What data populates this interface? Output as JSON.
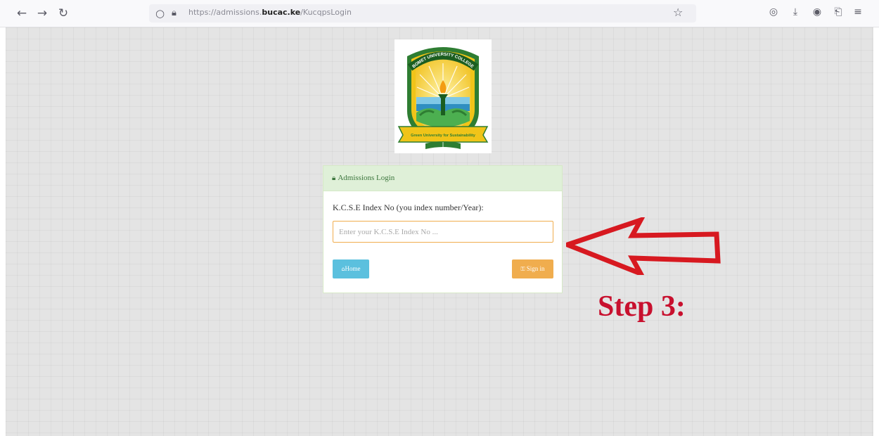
{
  "browser": {
    "url_prefix": "https://admissions.",
    "url_domain": "bucac.ke",
    "url_path": "/KucqpsLogin",
    "icons": {
      "back": "arrow-left-icon",
      "forward": "arrow-right-icon",
      "reload": "reload-icon",
      "shield": "shield-icon",
      "lock": "lock-icon",
      "bookmark": "star-icon",
      "pocket": "pocket-icon",
      "downloads": "download-icon",
      "account": "account-icon",
      "extensions": "extensions-icon",
      "menu": "menu-icon"
    }
  },
  "page": {
    "logo": {
      "arc_text": "BOMET UNIVERSITY COLLEGE",
      "ribbon_text": "Green University for Sustainability"
    },
    "login_panel": {
      "heading": "Admissions Login",
      "field_label": "K.C.S.E Index No (you index number/Year):",
      "input_placeholder": "Enter your K.C.S.E Index No ...",
      "input_value": "",
      "home_button": "Home",
      "signin_button": "Sign in"
    }
  },
  "annotation": {
    "label": "Step 3:",
    "color": "#c8102e"
  },
  "colors": {
    "panel_heading_bg": "#dff0d8",
    "home_button": "#5bc0de",
    "signin_button": "#f0ad4e",
    "input_border": "#f0ad4e",
    "page_bg": "#e4e4e4"
  }
}
